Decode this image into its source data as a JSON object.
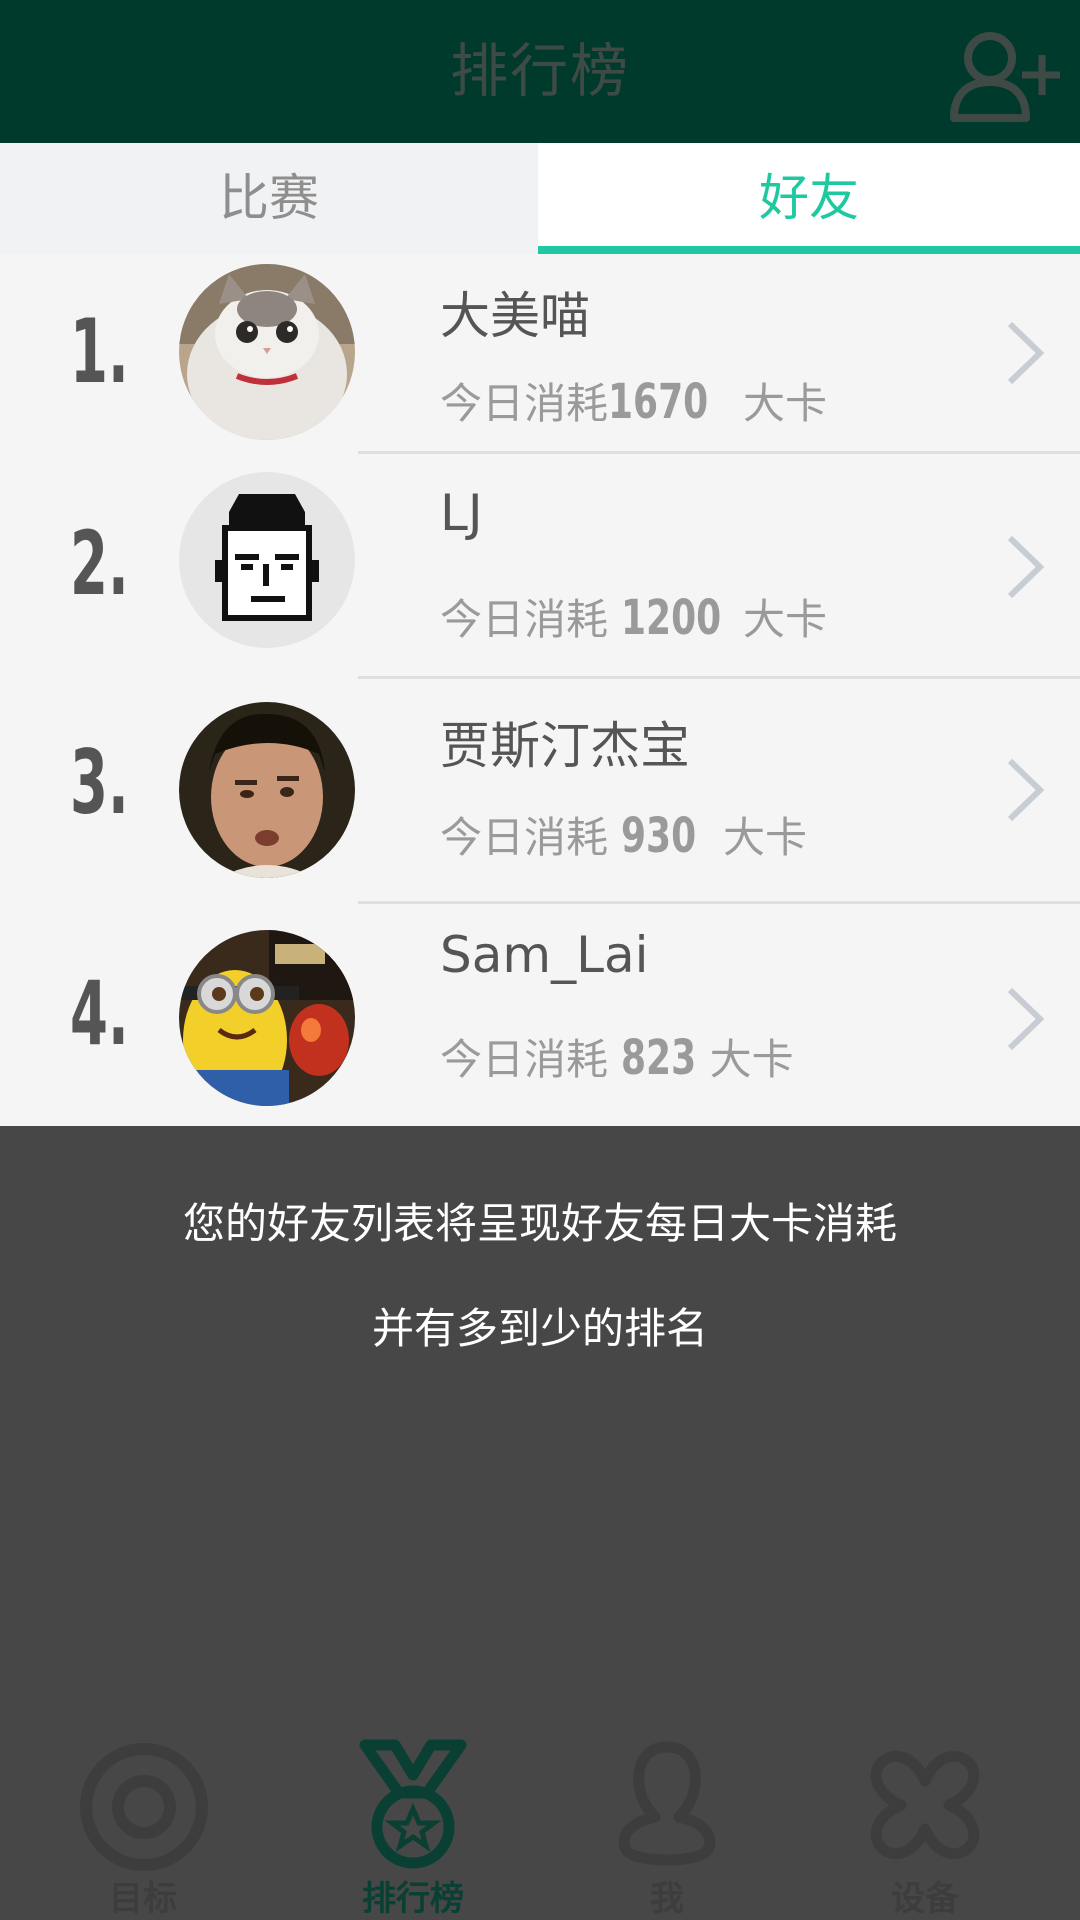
{
  "header": {
    "title": "排行榜",
    "add_friend_icon": "add-user-icon"
  },
  "tabs": [
    {
      "label": "比赛",
      "active": false
    },
    {
      "label": "好友",
      "active": true
    }
  ],
  "friends": [
    {
      "rank": "1.",
      "name": "大美喵",
      "sub_prefix": "今日消耗",
      "calories": "1670",
      "unit": "大卡",
      "avatar": "cat-photo"
    },
    {
      "rank": "2.",
      "name": "LJ",
      "sub_prefix": "今日消耗",
      "calories": "1200",
      "unit": "大卡",
      "avatar": "pixel-face"
    },
    {
      "rank": "3.",
      "name": "贾斯汀杰宝",
      "sub_prefix": "今日消耗",
      "calories": "930",
      "unit": "大卡",
      "avatar": "man-photo"
    },
    {
      "rank": "4.",
      "name": "Sam_Lai",
      "sub_prefix": "今日消耗",
      "calories": "823",
      "unit": "大卡",
      "avatar": "minion-photo"
    }
  ],
  "overlay": {
    "line1": "您的好友列表将呈现好友每日大卡消耗",
    "line2": "并有多到少的排名"
  },
  "nav": [
    {
      "label": "目标",
      "icon": "target-icon",
      "active": false
    },
    {
      "label": "排行榜",
      "icon": "medal-icon",
      "active": true
    },
    {
      "label": "我",
      "icon": "person-icon",
      "active": false
    },
    {
      "label": "设备",
      "icon": "device-icon",
      "active": false
    }
  ],
  "colors": {
    "header_bg": "#003a2c",
    "accent": "#1fc9a0",
    "overlay_bg": "#474747",
    "nav_active": "#0a3f33"
  }
}
